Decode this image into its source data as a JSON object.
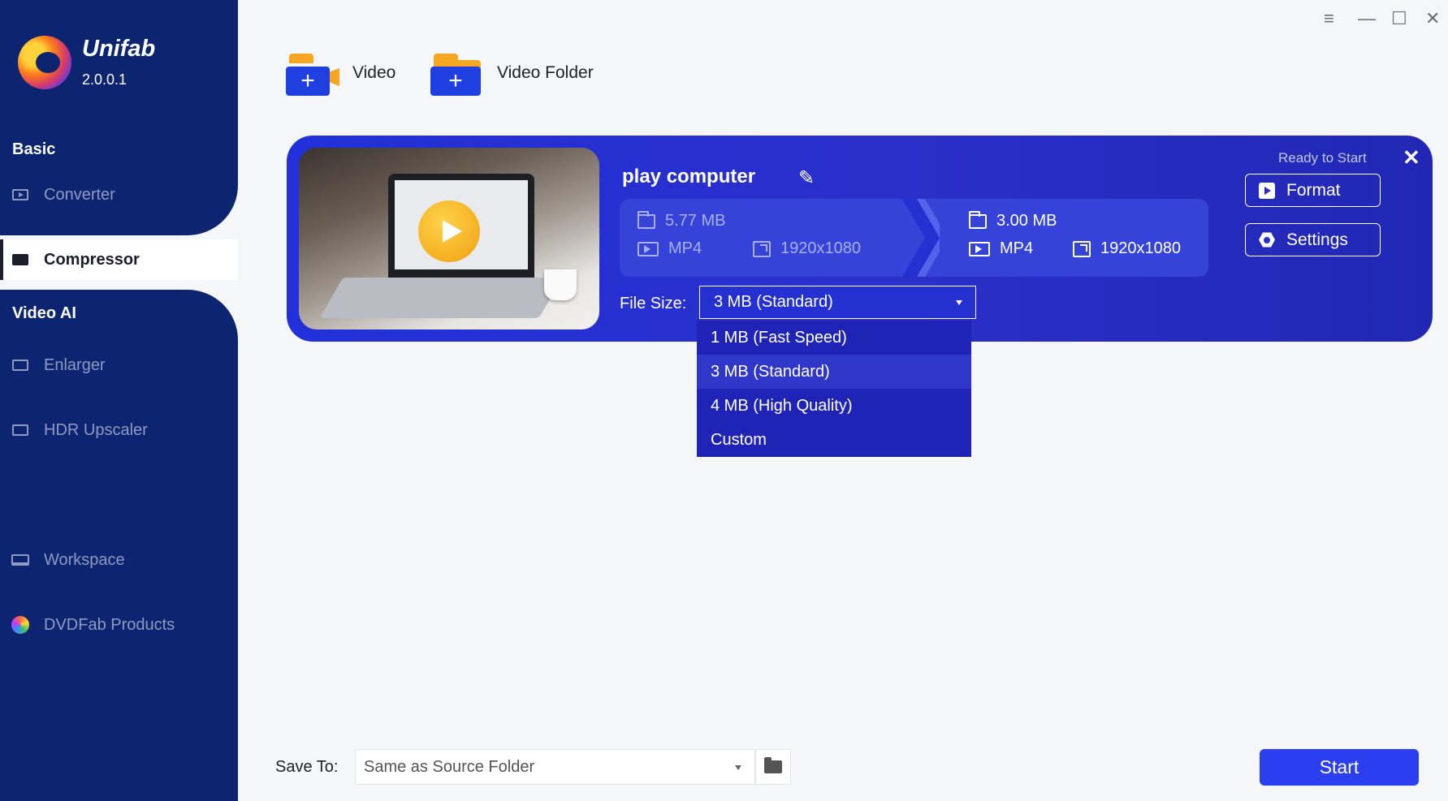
{
  "app": {
    "name": "Unifab",
    "version": "2.0.0.1"
  },
  "sidebar": {
    "basic_title": "Basic",
    "video_ai_title": "Video AI",
    "items": [
      {
        "label": "Converter",
        "icon": "converter-icon"
      },
      {
        "label": "Compressor",
        "icon": "compressor-icon",
        "active": true
      },
      {
        "label": "Enlarger",
        "icon": "enlarger-icon"
      },
      {
        "label": "HDR Upscaler",
        "icon": "hdr-icon"
      },
      {
        "label": "Workspace",
        "icon": "monitor-icon"
      },
      {
        "label": "DVDFab Products",
        "icon": "dvdfab-icon"
      }
    ]
  },
  "window_controls": {
    "menu": "≡",
    "minimize": "—",
    "maximize": "☐",
    "close": "✕"
  },
  "toolbar": {
    "add_video": "Video",
    "add_folder": "Video Folder"
  },
  "task": {
    "title": "play computer",
    "status": "Ready to Start",
    "source": {
      "size": "5.77 MB",
      "format": "MP4",
      "resolution": "1920x1080"
    },
    "output": {
      "size": "3.00 MB",
      "format": "MP4",
      "resolution": "1920x1080"
    },
    "file_size_label": "File Size:",
    "file_size_selected": "3 MB (Standard)",
    "format_button": "Format",
    "settings_button": "Settings"
  },
  "dropdown": {
    "options": [
      "1 MB (Fast Speed)",
      "3 MB (Standard)",
      "4 MB (High Quality)",
      "Custom"
    ],
    "selected_index": 1
  },
  "bottom": {
    "save_to_label": "Save To:",
    "save_to_value": "Same as Source Folder",
    "start_button": "Start"
  },
  "colors": {
    "sidebar": "#0d2470",
    "card": "#2a2fc9",
    "accent": "#2b3ef0",
    "folder_orange": "#f5a623"
  }
}
